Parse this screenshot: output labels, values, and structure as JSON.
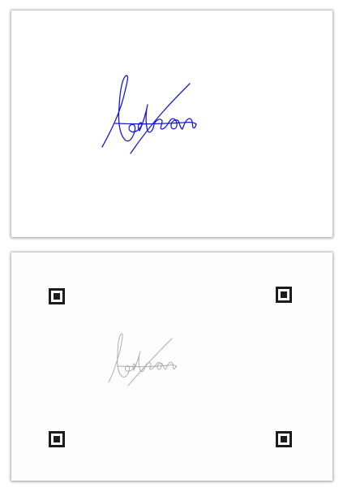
{
  "signature": {
    "text": "Letron",
    "ink_color": "#1a1ad6",
    "scan_ink_color": "#9a9a9a"
  },
  "scan": {
    "markers": [
      "marker-top-left",
      "marker-top-right",
      "marker-bottom-left",
      "marker-bottom-right"
    ]
  }
}
